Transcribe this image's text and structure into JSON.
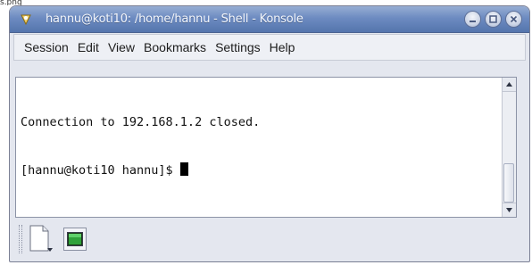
{
  "top_fragment": "s.png",
  "window": {
    "title": "hannu@koti10: /home/hannu - Shell - Konsole",
    "icons": {
      "app": "konsole-app-icon",
      "minimize": "minimize-icon",
      "maximize": "maximize-icon",
      "close": "close-icon"
    }
  },
  "menu": {
    "items": [
      "Session",
      "Edit",
      "View",
      "Bookmarks",
      "Settings",
      "Help"
    ]
  },
  "terminal": {
    "lines": [
      "Connection to 192.168.1.2 closed.",
      "[hannu@koti10 hannu]$ "
    ]
  },
  "tabbar": {
    "new_session_icon": "new-session-icon",
    "session_tab_icon": "terminal-session-icon"
  },
  "colors": {
    "titlebar": "#6d8bc1",
    "terminal_bg": "#ffffff",
    "terminal_fg": "#111111"
  }
}
